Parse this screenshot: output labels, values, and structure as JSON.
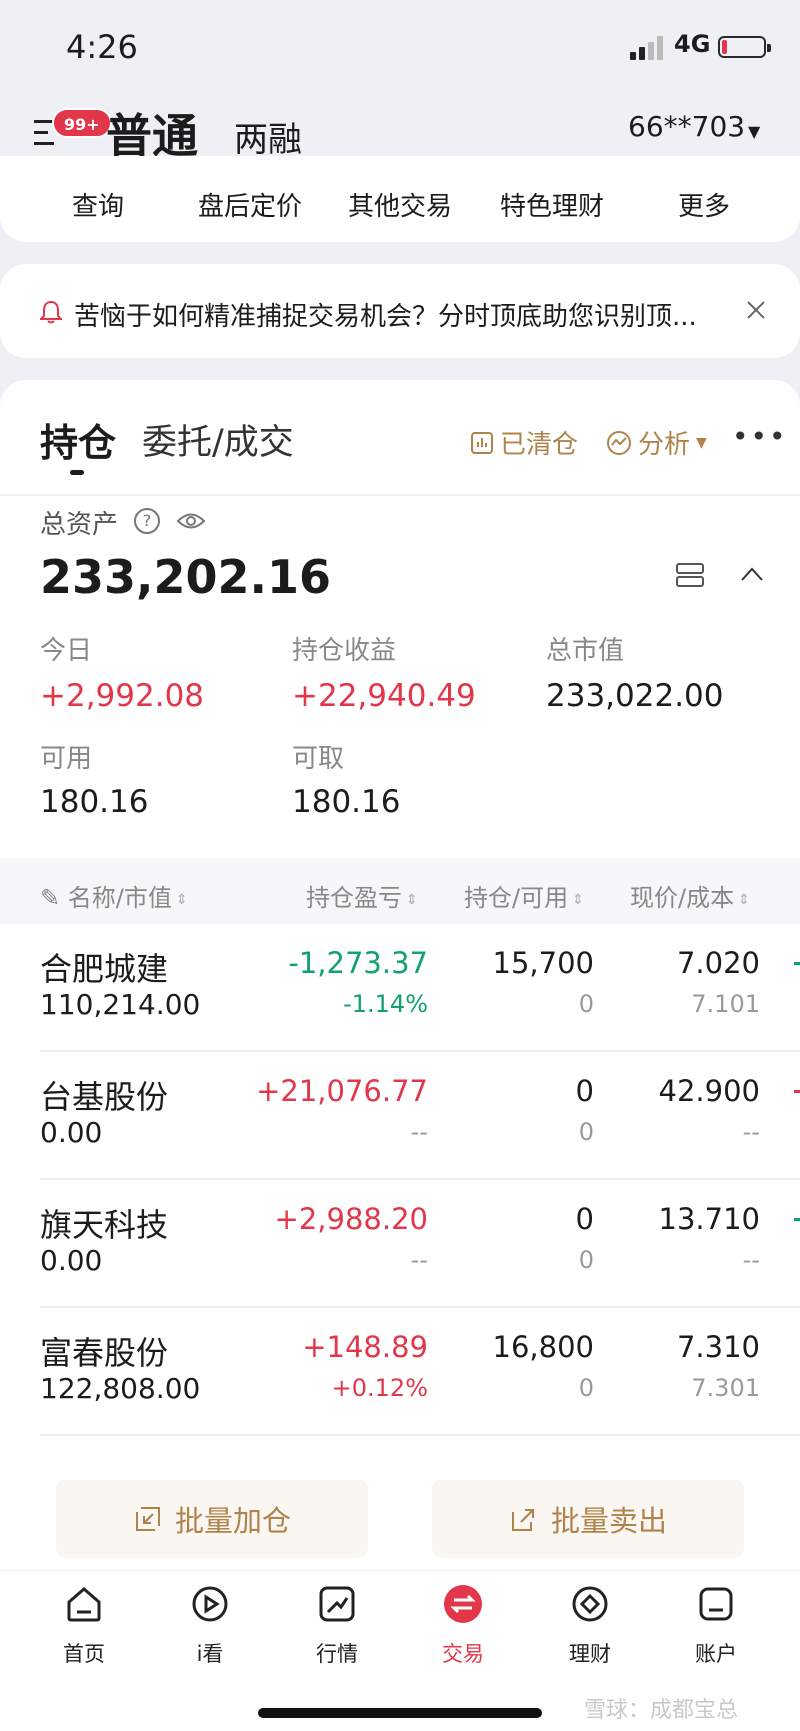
{
  "status": {
    "time": "4:26",
    "network": "4G"
  },
  "header": {
    "badge": "99+",
    "tab_normal": "普通",
    "tab_margin": "两融",
    "account": "66**703"
  },
  "top_menu": [
    "查询",
    "盘后定价",
    "其他交易",
    "特色理财",
    "更多"
  ],
  "notice": {
    "text": "苦恼于如何精准捕捉交易机会？分时顶底助您识别顶..."
  },
  "tabs": {
    "holdings": "持仓",
    "orders": "委托/成交",
    "cleared": "已清仓",
    "analysis": "分析"
  },
  "summary": {
    "total_label": "总资产",
    "help_glyph": "?",
    "total_value": "233,202.16",
    "today_label": "今日",
    "today_value": "+2,992.08",
    "pl_label": "持仓收益",
    "pl_value": "+22,940.49",
    "mkt_label": "总市值",
    "mkt_value": "233,022.00",
    "avail_label": "可用",
    "avail_value": "180.16",
    "withdraw_label": "可取",
    "withdraw_value": "180.16"
  },
  "table": {
    "headers": [
      "名称/市值",
      "持仓盈亏",
      "持仓/可用",
      "现价/成本"
    ],
    "rows": [
      {
        "name": "合肥城建",
        "market_value": "110,214.00",
        "pl": "-1,273.37",
        "pl_pct": "-1.14%",
        "hold": "15,700",
        "available": "0",
        "price": "7.020",
        "cost": "7.101",
        "tone": "green"
      },
      {
        "name": "台基股份",
        "market_value": "0.00",
        "pl": "+21,076.77",
        "pl_pct": "--",
        "hold": "0",
        "available": "0",
        "price": "42.900",
        "cost": "--",
        "tone": "red"
      },
      {
        "name": "旗天科技",
        "market_value": "0.00",
        "pl": "+2,988.20",
        "pl_pct": "--",
        "hold": "0",
        "available": "0",
        "price": "13.710",
        "cost": "--",
        "tone": "red"
      },
      {
        "name": "富春股份",
        "market_value": "122,808.00",
        "pl": "+148.89",
        "pl_pct": "+0.12%",
        "hold": "16,800",
        "available": "0",
        "price": "7.310",
        "cost": "7.301",
        "tone": "red"
      }
    ]
  },
  "batch": {
    "add": "批量加仓",
    "sell": "批量卖出"
  },
  "nav": [
    "首页",
    "i看",
    "行情",
    "交易",
    "理财",
    "账户"
  ],
  "colors": {
    "red": "#e2374a",
    "green": "#11a36b",
    "gold": "#b0834c"
  },
  "watermark": "雪球：成都宝总"
}
